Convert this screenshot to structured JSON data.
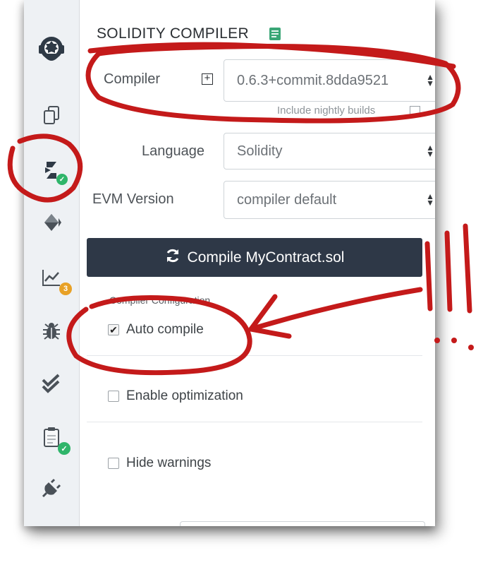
{
  "panel": {
    "title": "SOLIDITY COMPILER",
    "compiler_label": "Compiler",
    "compiler_value": "0.6.3+commit.8dda9521",
    "nightly_label": "Include nightly builds",
    "language_label": "Language",
    "language_value": "Solidity",
    "evm_label": "EVM Version",
    "evm_value": "compiler default",
    "compile_button": "Compile MyContract.sol",
    "config_heading": "Compiler Configuration",
    "auto_compile": {
      "label": "Auto compile",
      "checked": true
    },
    "optimization": {
      "label": "Enable optimization",
      "checked": false
    },
    "hide_warnings": {
      "label": "Hide warnings",
      "checked": false
    }
  },
  "sidebar": {
    "icons": [
      "remix-logo-icon",
      "file-explorer-icon",
      "solidity-compiler-icon",
      "deploy-run-icon",
      "analysis-icon",
      "debugger-icon",
      "unit-testing-icon",
      "tests-icon",
      "plugin-manager-icon"
    ],
    "analysis_badge": "3"
  },
  "annotation": {
    "marker_color": "#c41a1a",
    "exclamation": "!!!"
  },
  "colors": {
    "button_bg": "#2e3847",
    "badge_orange": "#e8a126",
    "badge_green": "#2fb56a"
  }
}
